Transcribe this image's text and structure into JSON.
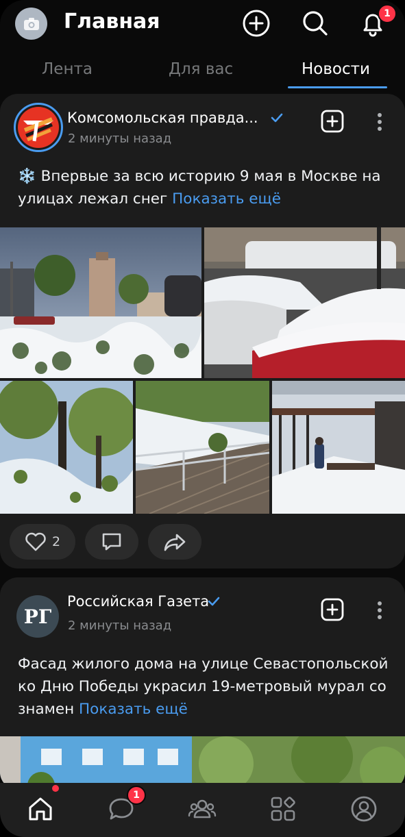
{
  "header": {
    "title": "Главная",
    "notification_count": "1"
  },
  "tabs": [
    {
      "label": "Лента",
      "active": false
    },
    {
      "label": "Для вас",
      "active": false
    },
    {
      "label": "Новости",
      "active": true
    }
  ],
  "posts": [
    {
      "source": "Комсомольская правда...",
      "time": "2 минуты назад",
      "emoji": "❄️",
      "text": "Впервые за всю историю 9 мая в Москве на улицах лежал снег",
      "show_more": "Показать ещё",
      "likes": "2"
    },
    {
      "source": "Российская Газета",
      "logo_text": "РГ",
      "time": "2 минуты назад",
      "text": "Фасад жилого дома на улице Севастопольской ко Дню Победы украсил 19-метровый мурал со знамен",
      "show_more": "Показать ещё"
    }
  ],
  "bottom_nav": {
    "messages_badge": "1"
  },
  "colors": {
    "accent": "#4a9cf0",
    "badge": "#ff3347",
    "card": "#1c1c1c"
  }
}
